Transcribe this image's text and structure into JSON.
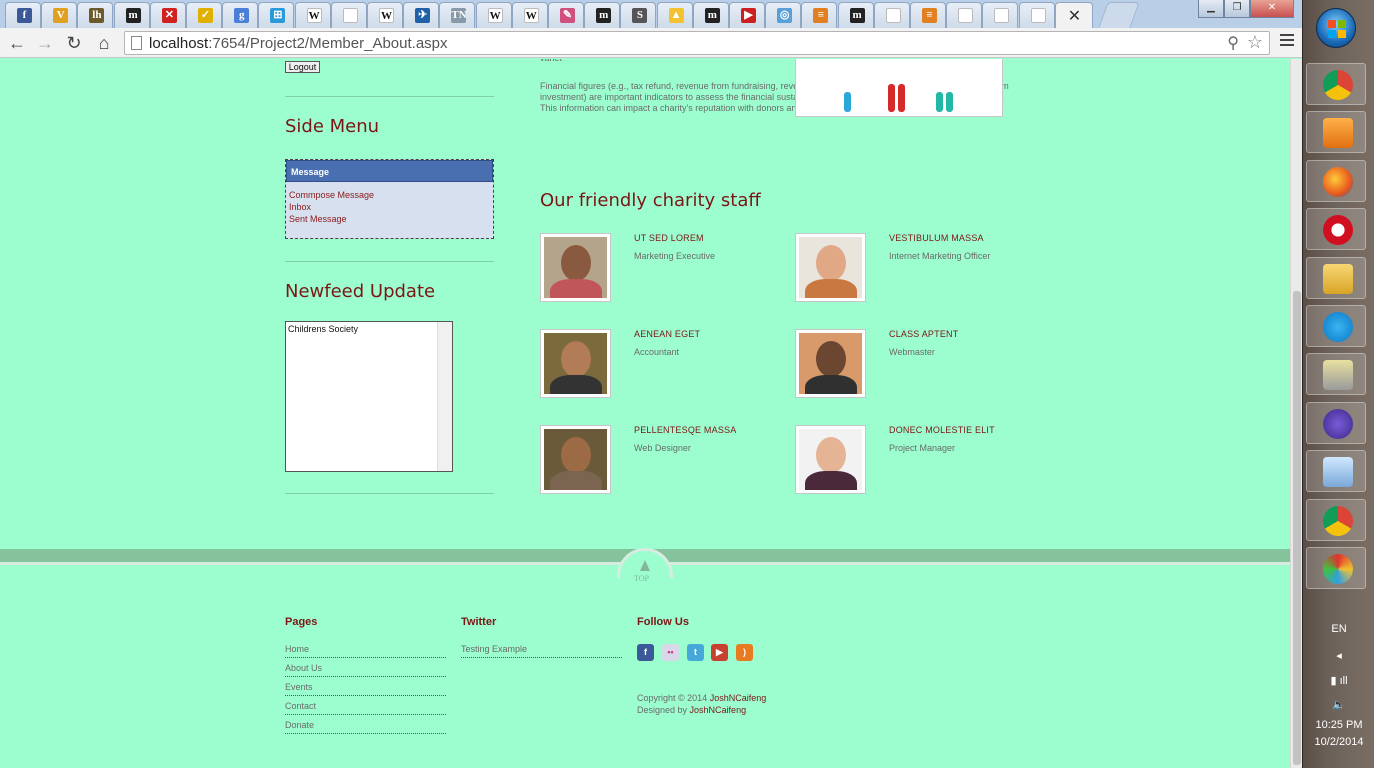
{
  "browser": {
    "tab_icons": [
      {
        "icon": "facebook-icon",
        "glyph": "f",
        "color": "#3b5998"
      },
      {
        "icon": "vimeo-icon",
        "glyph": "V",
        "color": "#e0a020"
      },
      {
        "icon": "lh-icon",
        "glyph": "lh",
        "color": "#6b5b2b"
      },
      {
        "icon": "m-icon",
        "glyph": "m",
        "color": "#222222"
      },
      {
        "icon": "red-x-icon",
        "glyph": "✕",
        "color": "#d02020"
      },
      {
        "icon": "check-icon",
        "glyph": "✓",
        "color": "#e0b000"
      },
      {
        "icon": "google-icon",
        "glyph": "g",
        "color": "#4a7fd8"
      },
      {
        "icon": "windows-icon",
        "glyph": "⊞",
        "color": "#2a9ad8"
      },
      {
        "icon": "wikipedia-icon",
        "glyph": "W",
        "color": "#ffffff"
      },
      {
        "icon": "page-icon",
        "glyph": "",
        "color": "#ffffff"
      },
      {
        "icon": "wikipedia-icon",
        "glyph": "W",
        "color": "#ffffff"
      },
      {
        "icon": "plane-icon",
        "glyph": "✈",
        "color": "#2060a8"
      },
      {
        "icon": "tn-icon",
        "glyph": "TN",
        "color": "#8899aa"
      },
      {
        "icon": "wikipedia-icon",
        "glyph": "W",
        "color": "#ffffff"
      },
      {
        "icon": "wikipedia-icon",
        "glyph": "W",
        "color": "#ffffff"
      },
      {
        "icon": "pen-icon",
        "glyph": "✎",
        "color": "#d05080"
      },
      {
        "icon": "m-icon",
        "glyph": "m",
        "color": "#222222"
      },
      {
        "icon": "st-icon",
        "glyph": "S",
        "color": "#555555"
      },
      {
        "icon": "drive-icon",
        "glyph": "▲",
        "color": "#f2c230"
      },
      {
        "icon": "m-icon",
        "glyph": "m",
        "color": "#222222"
      },
      {
        "icon": "youtube-icon",
        "glyph": "▶",
        "color": "#cc2020"
      },
      {
        "icon": "app-icon",
        "glyph": "◎",
        "color": "#5aa0d8"
      },
      {
        "icon": "stack-icon",
        "glyph": "≡",
        "color": "#e08020"
      },
      {
        "icon": "m-icon",
        "glyph": "m",
        "color": "#222222"
      },
      {
        "icon": "page-icon",
        "glyph": "",
        "color": "#ffffff"
      },
      {
        "icon": "stack-icon",
        "glyph": "≡",
        "color": "#e08020"
      },
      {
        "icon": "page-icon",
        "glyph": "",
        "color": "#ffffff"
      },
      {
        "icon": "page-icon",
        "glyph": "",
        "color": "#ffffff"
      },
      {
        "icon": "page-icon",
        "glyph": "",
        "color": "#ffffff"
      }
    ],
    "active_tab_close": "✕",
    "url_host": "localhost",
    "url_path": ":7654/Project2/Member_About.aspx"
  },
  "sidebar": {
    "logout_label": "Logout",
    "side_menu_title": "Side Menu",
    "message_header": "Message",
    "message_links": [
      "Commpose Message",
      "Inbox",
      "Sent Message"
    ],
    "newsfeed_title": "Newfeed Update",
    "newsfeed_items": [
      "Childrens Society"
    ]
  },
  "content": {
    "partial_word": "variet",
    "paragraph": "Financial figures (e.g., tax refund, revenue from fundraising, revenue from sale of goods and services or revenue from investment) are important indicators to assess the financial sustainability of a charity, especially to charity evaluators. This information can impact a charity's reputation with donors and societies, and thus, the charity's financial gains.",
    "staff_title": "Our friendly charity staff",
    "staff": [
      {
        "name": "UT SED LOREM",
        "role": "Marketing Executive"
      },
      {
        "name": "VESTIBULUM MASSA",
        "role": "Internet Marketing Officer"
      },
      {
        "name": "AENEAN EGET",
        "role": "Accountant"
      },
      {
        "name": "CLASS APTENT",
        "role": "Webmaster"
      },
      {
        "name": "PELLENTESQE MASSA",
        "role": "Web Designer"
      },
      {
        "name": "DONEC MOLESTIE ELIT",
        "role": "Project Manager"
      }
    ]
  },
  "footer": {
    "top_label": "TOP",
    "pages_title": "Pages",
    "pages": [
      "Home",
      "About Us",
      "Events",
      "Contact",
      "Donate"
    ],
    "twitter_title": "Twitter",
    "twitter_items": [
      "Testing Example"
    ],
    "follow_title": "Follow Us",
    "social": [
      {
        "icon": "facebook-icon",
        "glyph": "f",
        "color": "#3b5998"
      },
      {
        "icon": "flickr-icon",
        "glyph": "••",
        "color": "#d8d8e8"
      },
      {
        "icon": "twitter-icon",
        "glyph": "t",
        "color": "#45a8d8"
      },
      {
        "icon": "youtube-icon",
        "glyph": "▶",
        "color": "#c84030"
      },
      {
        "icon": "rss-icon",
        "glyph": ")",
        "color": "#e87a20"
      }
    ],
    "copyright_prefix": "Copyright © 2014 ",
    "copyright_name": "JoshNCaifeng",
    "designed_prefix": "Designed by ",
    "designed_name": "JoshNCaifeng"
  },
  "taskbar": {
    "apps": [
      {
        "icon": "chrome-icon"
      },
      {
        "icon": "media-player-icon"
      },
      {
        "icon": "firefox-icon"
      },
      {
        "icon": "opera-icon"
      },
      {
        "icon": "file-explorer-icon"
      },
      {
        "icon": "skype-icon"
      },
      {
        "icon": "tools-icon"
      },
      {
        "icon": "visual-studio-icon"
      },
      {
        "icon": "notepad-icon"
      },
      {
        "icon": "chrome-icon"
      },
      {
        "icon": "paint-icon"
      }
    ],
    "language": "EN",
    "time": "10:25 PM",
    "date": "10/2/2014"
  }
}
